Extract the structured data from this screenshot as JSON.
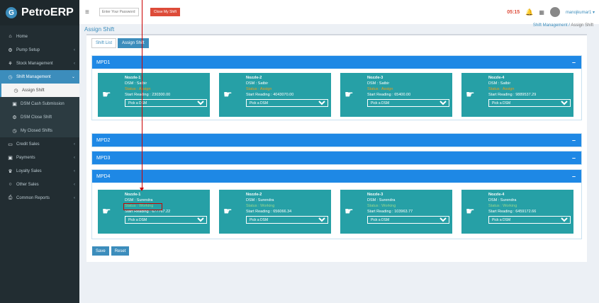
{
  "app": {
    "logo_letter": "G",
    "title": "PetroERP"
  },
  "sidebar": {
    "items": [
      {
        "label": "Home",
        "icon": "home-icon",
        "glyph": "⌂"
      },
      {
        "label": "Pump Setup",
        "icon": "gears-icon",
        "glyph": "⚙"
      },
      {
        "label": "Stock Management",
        "icon": "cubes-icon",
        "glyph": "⚘"
      },
      {
        "label": "Shift Management",
        "icon": "clock-icon",
        "glyph": "◷"
      },
      {
        "label": "Assign Shift",
        "icon": "clock-icon",
        "glyph": "◷"
      },
      {
        "label": "DSM Cash Submission",
        "icon": "money-icon",
        "glyph": "▣"
      },
      {
        "label": "DSM Close Shift",
        "icon": "gear-icon",
        "glyph": "⚙"
      },
      {
        "label": "My Closed Shifts",
        "icon": "clock-icon",
        "glyph": "◷"
      },
      {
        "label": "Credit Sales",
        "icon": "credit-card-icon",
        "glyph": "▭"
      },
      {
        "label": "Payments",
        "icon": "money-icon",
        "glyph": "▣"
      },
      {
        "label": "Loyalty Sales",
        "icon": "trophy-icon",
        "glyph": "♛"
      },
      {
        "label": "Other Sales",
        "icon": "circle-icon",
        "glyph": "○"
      },
      {
        "label": "Common Reports",
        "icon": "print-icon",
        "glyph": "⎙"
      }
    ]
  },
  "topbar": {
    "search_placeholder": "Enter Your Password",
    "close_shift_label": "Close My Shift",
    "timer": "05:15",
    "user": "manojkumar1 ▾"
  },
  "page": {
    "title": "Assign Shift",
    "breadcrumb_parent": "Shift Management",
    "breadcrumb_sep": "/",
    "breadcrumb_current": "Assign Shift"
  },
  "tabs": {
    "shift_list": "Shift List",
    "assign_shift": "Assign Shift"
  },
  "mpds": [
    {
      "label": "MPD1",
      "collapse": "–",
      "nozzles": [
        {
          "name": "Nozzle-1",
          "dsm": "DSM : Satbir",
          "status": "Status : Assign",
          "reading": "Start Reading : 230300.00",
          "select": "Pick a DSM"
        },
        {
          "name": "Nozzle-2",
          "dsm": "DSM : Satbir",
          "status": "Status : Assign",
          "reading": "Start Reading : 4043070.00",
          "select": "Pick a DSM"
        },
        {
          "name": "Nozzle-3",
          "dsm": "DSM : Satbir",
          "status": "Status : Assign",
          "reading": "Start Reading : 65400.00",
          "select": "Pick a DSM"
        },
        {
          "name": "Nozzle-4",
          "dsm": "DSM : Satbir",
          "status": "Status : Assign",
          "reading": "Start Reading : 9889537.29",
          "select": "Pick a DSM"
        }
      ]
    },
    {
      "label": "MPD2",
      "collapse": "–"
    },
    {
      "label": "MPD3",
      "collapse": "–"
    },
    {
      "label": "MPD4",
      "collapse": "–",
      "nozzles": [
        {
          "name": "Nozzle-1",
          "dsm": "DSM : Surendra",
          "status": "Status : Working",
          "reading": "Start Reading : 677767.22",
          "select": "Pick a DSM"
        },
        {
          "name": "Nozzle-2",
          "dsm": "DSM : Surendra",
          "status": "Status : Working",
          "reading": "Start Reading : 656066.34",
          "select": "Pick a DSM"
        },
        {
          "name": "Nozzle-3",
          "dsm": "DSM : Surendra",
          "status": "Status : Working",
          "reading": "Start Reading : 103963.77",
          "select": "Pick a DSM"
        },
        {
          "name": "Nozzle-4",
          "dsm": "DSM : Surendra",
          "status": "Status : Working",
          "reading": "Start Reading : 6459172.66",
          "select": "Pick a DSM"
        }
      ]
    }
  ],
  "actions": {
    "save": "Save",
    "reset": "Reset"
  },
  "colors": {
    "accent": "#1e88e5",
    "nozzle": "#26a0a6",
    "status_assign": "#f39c12",
    "status_working": "#9bd88b",
    "danger": "#dd4b39"
  }
}
